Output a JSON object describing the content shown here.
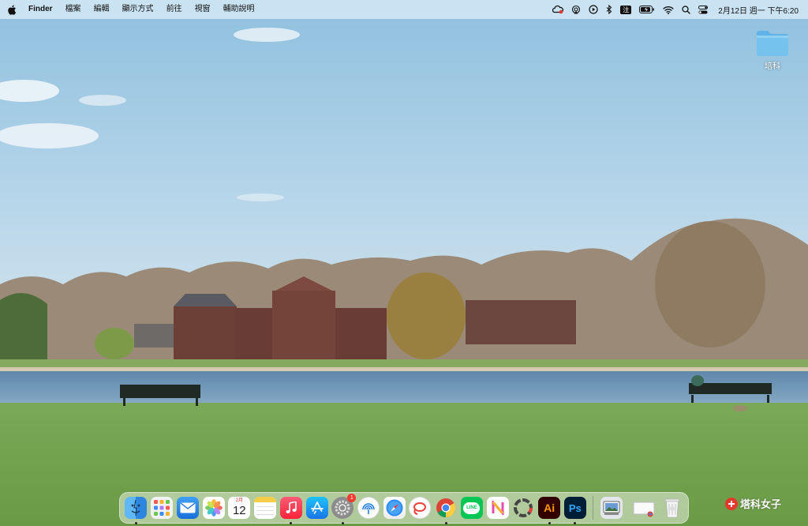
{
  "menubar": {
    "app_name": "Finder",
    "menus": [
      "檔案",
      "編輯",
      "顯示方式",
      "前往",
      "視窗",
      "輔助說明"
    ],
    "input_method": "注",
    "clock": "2月12日 週一  下午6:20"
  },
  "desktop": {
    "folder_label": "培科"
  },
  "dock": {
    "calendar_month": "2月",
    "calendar_day": "12",
    "settings_badge": "1",
    "line_label": "LINE",
    "ai_label": "Ai",
    "ps_label": "Ps"
  },
  "watermark": {
    "text": "塔科女子"
  },
  "colors": {
    "sky": "#a9cfe6",
    "lawn": "#6e9d4c",
    "water": "#6f95b6"
  }
}
